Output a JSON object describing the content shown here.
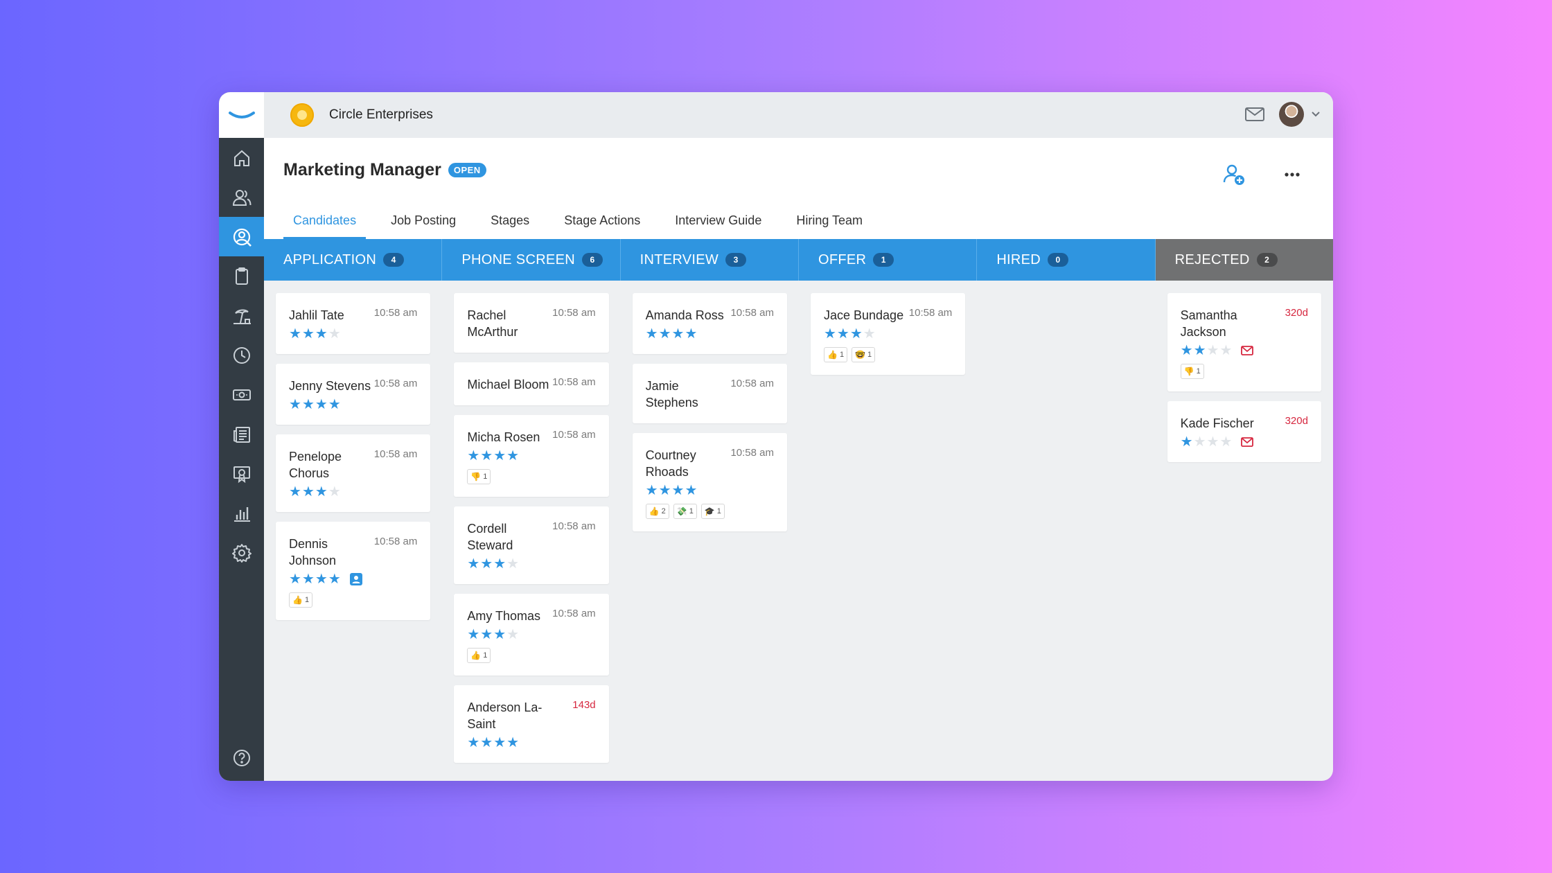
{
  "company": {
    "name": "Circle Enterprises"
  },
  "job": {
    "title": "Marketing Manager",
    "status": "OPEN"
  },
  "tabs": [
    "Candidates",
    "Job Posting",
    "Stages",
    "Stage Actions",
    "Interview Guide",
    "Hiring Team"
  ],
  "active_tab": "Candidates",
  "sidebar": {
    "items": [
      "home-icon",
      "people-icon",
      "candidate-search-icon",
      "clipboard-icon",
      "vacation-icon",
      "clock-icon",
      "money-icon",
      "news-icon",
      "training-icon",
      "reports-icon",
      "settings-icon"
    ],
    "active": "candidate-search-icon",
    "help": "help-icon"
  },
  "colors": {
    "accent": "#2f95e0",
    "sidebar": "#333c44",
    "rejected": "#707172",
    "late": "#d6273f"
  },
  "columns": [
    {
      "label": "APPLICATION",
      "count": "4",
      "cards": [
        {
          "name": "Jahlil Tate",
          "time": "10:58 am",
          "stars": 3,
          "reactions": []
        },
        {
          "name": "Jenny Stevens",
          "time": "10:58 am",
          "stars": 4,
          "reactions": []
        },
        {
          "name": "Penelope Chorus",
          "time": "10:58 am",
          "stars": 3,
          "reactions": []
        },
        {
          "name": "Dennis Johnson",
          "time": "10:58 am",
          "stars": 4,
          "badge": "profile-icon",
          "reactions": [
            {
              "emoji": "👍",
              "count": "1"
            }
          ]
        }
      ]
    },
    {
      "label": "PHONE SCREEN",
      "count": "6",
      "cards": [
        {
          "name": "Rachel McArthur",
          "time": "10:58 am",
          "stars": 0,
          "reactions": []
        },
        {
          "name": "Michael Bloom",
          "time": "10:58 am",
          "stars": 0,
          "reactions": []
        },
        {
          "name": "Micha Rosen",
          "time": "10:58 am",
          "stars": 4,
          "reactions": [
            {
              "emoji": "👎",
              "count": "1"
            }
          ]
        },
        {
          "name": "Cordell Steward",
          "time": "10:58 am",
          "stars": 3,
          "reactions": []
        },
        {
          "name": "Amy Thomas",
          "time": "10:58 am",
          "stars": 3,
          "reactions": [
            {
              "emoji": "👍",
              "count": "1"
            }
          ]
        },
        {
          "name": "Anderson La-Saint",
          "time": "143d",
          "late": true,
          "stars": 4,
          "reactions": []
        }
      ]
    },
    {
      "label": "INTERVIEW",
      "count": "3",
      "cards": [
        {
          "name": "Amanda Ross",
          "time": "10:58 am",
          "stars": 4,
          "reactions": []
        },
        {
          "name": "Jamie Stephens",
          "time": "10:58 am",
          "stars": 0,
          "reactions": []
        },
        {
          "name": "Courtney Rhoads",
          "time": "10:58 am",
          "stars": 4,
          "reactions": [
            {
              "emoji": "👍",
              "count": "2"
            },
            {
              "emoji": "💸",
              "count": "1"
            },
            {
              "emoji": "🎓",
              "count": "1"
            }
          ]
        }
      ]
    },
    {
      "label": "OFFER",
      "count": "1",
      "cards": [
        {
          "name": "Jace Bundage",
          "time": "10:58 am",
          "stars": 3,
          "reactions": [
            {
              "emoji": "👍",
              "count": "1"
            },
            {
              "emoji": "🤓",
              "count": "1"
            }
          ]
        }
      ]
    },
    {
      "label": "HIRED",
      "count": "0",
      "cards": []
    },
    {
      "label": "REJECTED",
      "count": "2",
      "rejected": true,
      "cards": [
        {
          "name": "Samantha Jackson",
          "time": "320d",
          "late": true,
          "stars": 2,
          "badge": "mail-icon",
          "reactions": [
            {
              "emoji": "👎",
              "count": "1"
            }
          ]
        },
        {
          "name": "Kade Fischer",
          "time": "320d",
          "late": true,
          "stars": 1,
          "badge": "mail-icon",
          "reactions": []
        }
      ]
    }
  ]
}
